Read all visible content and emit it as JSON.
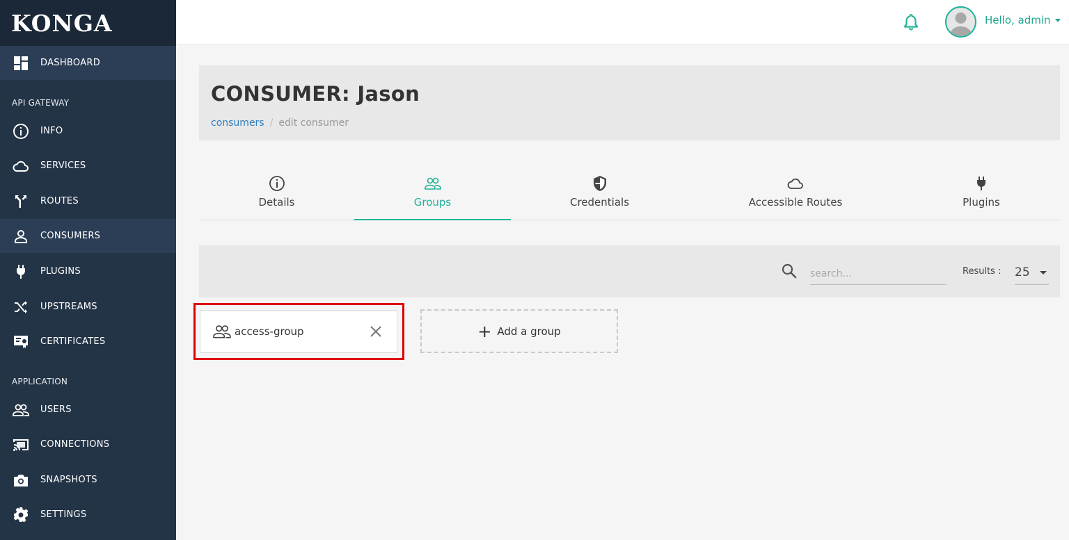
{
  "brand": {
    "name": "KONGA"
  },
  "sidebar": {
    "dashboard": "DASHBOARD",
    "section_api": "API GATEWAY",
    "api_items": [
      {
        "label": "INFO",
        "icon": "info-icon"
      },
      {
        "label": "SERVICES",
        "icon": "cloud-icon"
      },
      {
        "label": "ROUTES",
        "icon": "routes-icon"
      },
      {
        "label": "CONSUMERS",
        "icon": "user-icon",
        "active": true
      },
      {
        "label": "PLUGINS",
        "icon": "plug-icon"
      },
      {
        "label": "UPSTREAMS",
        "icon": "shuffle-icon"
      },
      {
        "label": "CERTIFICATES",
        "icon": "certificate-icon"
      }
    ],
    "section_app": "APPLICATION",
    "app_items": [
      {
        "label": "USERS",
        "icon": "users-icon"
      },
      {
        "label": "CONNECTIONS",
        "icon": "cast-icon"
      },
      {
        "label": "SNAPSHOTS",
        "icon": "camera-icon"
      },
      {
        "label": "SETTINGS",
        "icon": "gear-icon"
      }
    ]
  },
  "topbar": {
    "greeting": "Hello, admin"
  },
  "header": {
    "title": "CONSUMER: Jason",
    "breadcrumb_link": "consumers",
    "breadcrumb_sep": "/",
    "breadcrumb_current": "edit consumer"
  },
  "tabs": [
    {
      "label": "Details",
      "icon": "info-icon"
    },
    {
      "label": "Groups",
      "icon": "users-icon",
      "active": true
    },
    {
      "label": "Credentials",
      "icon": "shield-icon"
    },
    {
      "label": "Accessible Routes",
      "icon": "cloud-icon"
    },
    {
      "label": "Plugins",
      "icon": "plug-icon"
    }
  ],
  "search": {
    "placeholder": "search...",
    "results_label": "Results :",
    "results_value": "25"
  },
  "groups": [
    {
      "name": "access-group"
    }
  ],
  "add_group_label": "Add a group",
  "colors": {
    "accent": "#1fb29a",
    "sidebar": "#243447",
    "highlight": "#e00000",
    "link": "#2d7fc1"
  }
}
